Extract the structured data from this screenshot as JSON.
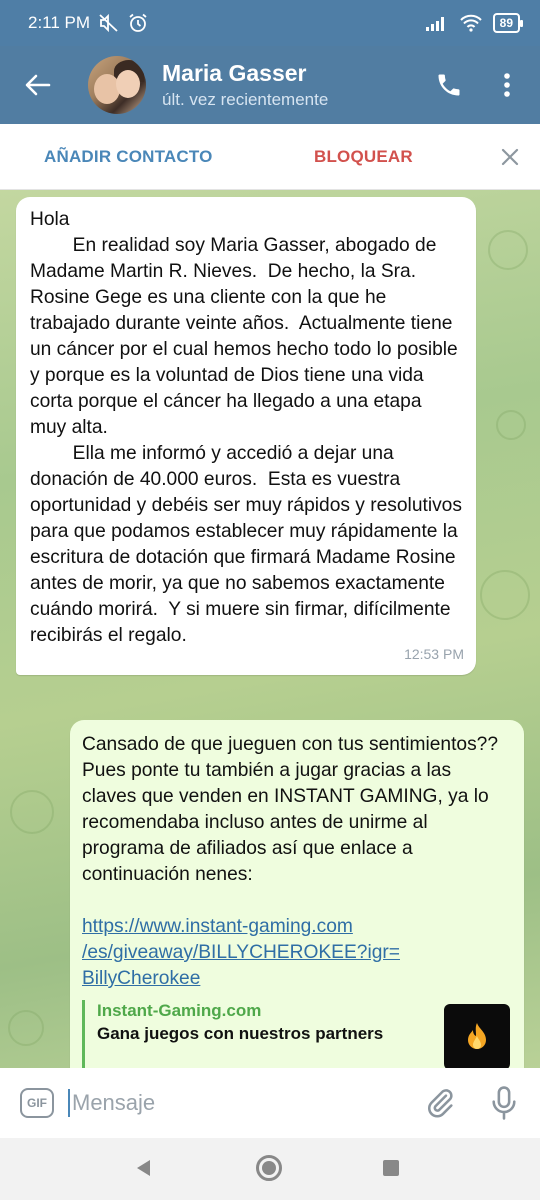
{
  "status_bar": {
    "time": "2:11 PM",
    "battery": "89",
    "icons": [
      "mute-icon",
      "alarm-icon",
      "signal-icon",
      "wifi-icon",
      "battery-icon"
    ]
  },
  "header": {
    "name": "Maria Gasser",
    "status": "últ. vez recientemente",
    "icons": [
      "back-arrow-icon",
      "avatar",
      "phone-icon",
      "more-vertical-icon"
    ]
  },
  "actions": {
    "add_contact": "AÑADIR CONTACTO",
    "block": "BLOQUEAR",
    "accent_add": "#4a87b8",
    "accent_block": "#d2514d"
  },
  "messages": [
    {
      "direction": "incoming",
      "text": "Hola\n        En realidad soy Maria Gasser, abogado de Madame Martin R. Nieves.  De hecho, la Sra. Rosine Gege es una cliente con la que he trabajado durante veinte años.  Actualmente tiene un cáncer por el cual hemos hecho todo lo posible y porque es la voluntad de Dios tiene una vida corta porque el cáncer ha llegado a una etapa muy alta.\n        Ella me informó y accedió a dejar una donación de 40.000 euros.  Esta es vuestra oportunidad y debéis ser muy rápidos y resolutivos para que podamos establecer muy rápidamente la escritura de dotación que firmará Madame Rosine antes de morir, ya que no sabemos exactamente cuándo morirá.  Y si muere sin firmar, difícilmente recibirás el regalo.",
      "time": "12:53 PM"
    },
    {
      "direction": "outgoing",
      "text": "Cansado de que jueguen con tus sentimientos?? Pues ponte tu también a jugar gracias a las claves que venden en INSTANT GAMING, ya lo recomendaba incluso antes de unirme al programa de afiliados así que enlace a continuación nenes:",
      "link": "https://www.instant-gaming.com\n/es/giveaway/BILLYCHEROKEE?igr=\nBillyCherokee",
      "preview_site": "Instant-Gaming.com",
      "preview_desc": "Gana juegos con nuestros partners"
    }
  ],
  "input": {
    "gif_label": "GIF",
    "placeholder": "Mensaje",
    "icons": [
      "gif-icon",
      "attach-icon",
      "mic-icon"
    ]
  },
  "colors": {
    "header_bg": "#517da2",
    "incoming_bubble": "#ffffff",
    "outgoing_bubble": "#effdde",
    "link": "#2f6ea5",
    "preview_accent": "#4fa84a"
  }
}
